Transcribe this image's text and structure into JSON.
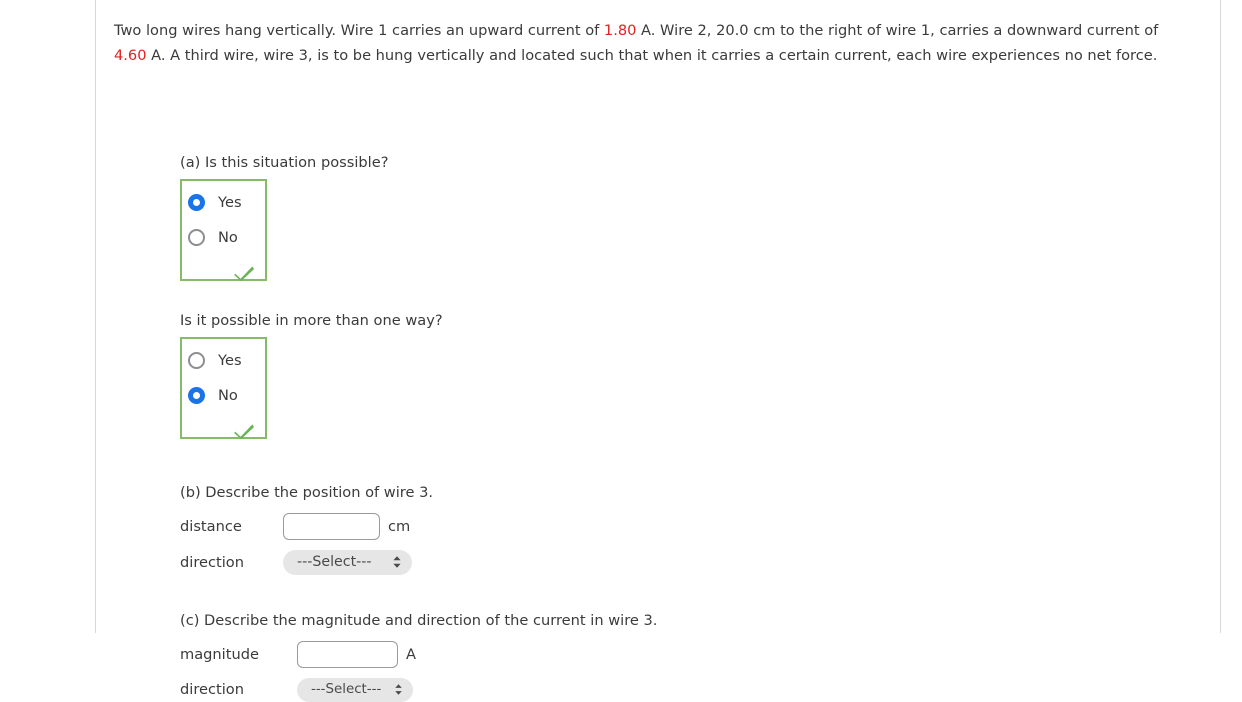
{
  "problem": {
    "text_part_1": "Two long wires hang vertically. Wire 1 carries an upward current of ",
    "current_1": "1.80",
    "text_part_2": " A. Wire 2, 20.0 cm to the right of wire 1, carries a downward current of ",
    "current_2": "4.60",
    "text_part_3": " A. A third wire, wire 3, is to be hung vertically and located such that when it carries a certain current, each wire experiences no net force."
  },
  "colors": {
    "value_red": "#e02020",
    "radio_selected_blue": "#1a73e8",
    "correct_green_border": "#86bb6a",
    "checkmark_green": "#6cb257",
    "select_background": "#e6e6e6"
  },
  "part_a": {
    "question": "(a) Is this situation possible?",
    "options": [
      {
        "label": "Yes",
        "selected": true
      },
      {
        "label": "No",
        "selected": false
      }
    ],
    "status_icon": "check-icon",
    "status": "correct"
  },
  "part_a_more": {
    "question": "Is it possible in more than one way?",
    "options": [
      {
        "label": "Yes",
        "selected": false
      },
      {
        "label": "No",
        "selected": true
      }
    ],
    "status_icon": "check-icon",
    "status": "correct"
  },
  "part_b": {
    "question": "(b) Describe the position of wire 3.",
    "distance": {
      "label": "distance",
      "value": "",
      "placeholder": "",
      "unit": "cm"
    },
    "direction": {
      "label": "direction",
      "selected_option": "---Select---",
      "chevron_icon": "chevron-up-down-icon"
    }
  },
  "part_c": {
    "question": "(c) Describe the magnitude and direction of the current in wire 3.",
    "magnitude": {
      "label": "magnitude",
      "value": "",
      "placeholder": "",
      "unit": "A"
    },
    "direction": {
      "label": "direction",
      "selected_option": "---Select---",
      "chevron_icon": "chevron-up-down-icon"
    }
  }
}
